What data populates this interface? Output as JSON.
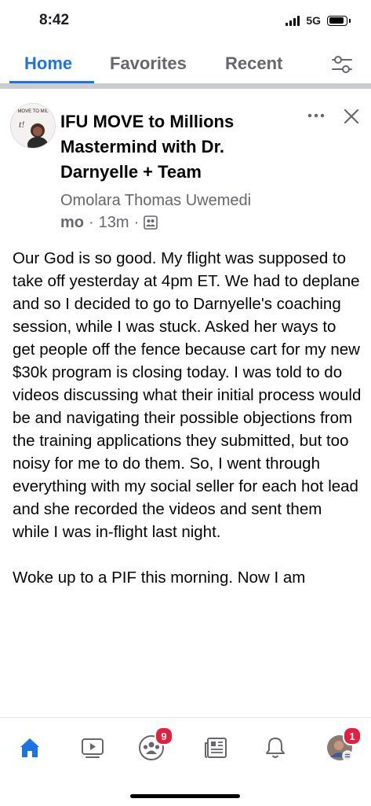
{
  "status_bar": {
    "time": "8:42",
    "network": "5G",
    "battery_level": 0.9
  },
  "tabs": [
    {
      "label": "Home",
      "active": true
    },
    {
      "label": "Favorites",
      "active": false
    },
    {
      "label": "Recent",
      "active": false
    }
  ],
  "post": {
    "group_name": "IFU MOVE to Millions Mastermind with Dr. Darnyelle + Team",
    "avatar_text": "MOVE TO MIL",
    "author": "Omolara Thomas Uwemedi",
    "author_suffix": "mo",
    "time": "13m",
    "separator": "·",
    "paragraph1": "Our God is so good. My flight was supposed to take off yesterday at 4pm ET. We had to deplane and so I decided to go to Darnyelle's coaching session, while I was stuck. Asked her ways to get people off the fence because cart for my new $30k program is closing today. I was told to do videos discussing what their initial process would be and navigating their possible objections from the training applications they submitted, but too noisy for me to do them. So, I went through everything with my social seller for each hot lead and she recorded the videos and sent them while I was in-flight last night.",
    "paragraph2": "Woke up to a PIF this morning. Now I am"
  },
  "bottom_nav": {
    "items": [
      {
        "icon": "home-icon",
        "active": true
      },
      {
        "icon": "video-icon"
      },
      {
        "icon": "groups-icon",
        "badge": "9"
      },
      {
        "icon": "news-icon"
      },
      {
        "icon": "bell-icon"
      },
      {
        "icon": "profile-icon",
        "badge": "1"
      }
    ]
  },
  "colors": {
    "accent": "#1b74e4",
    "badge": "#e41e3f",
    "secondary_text": "#65676b"
  }
}
